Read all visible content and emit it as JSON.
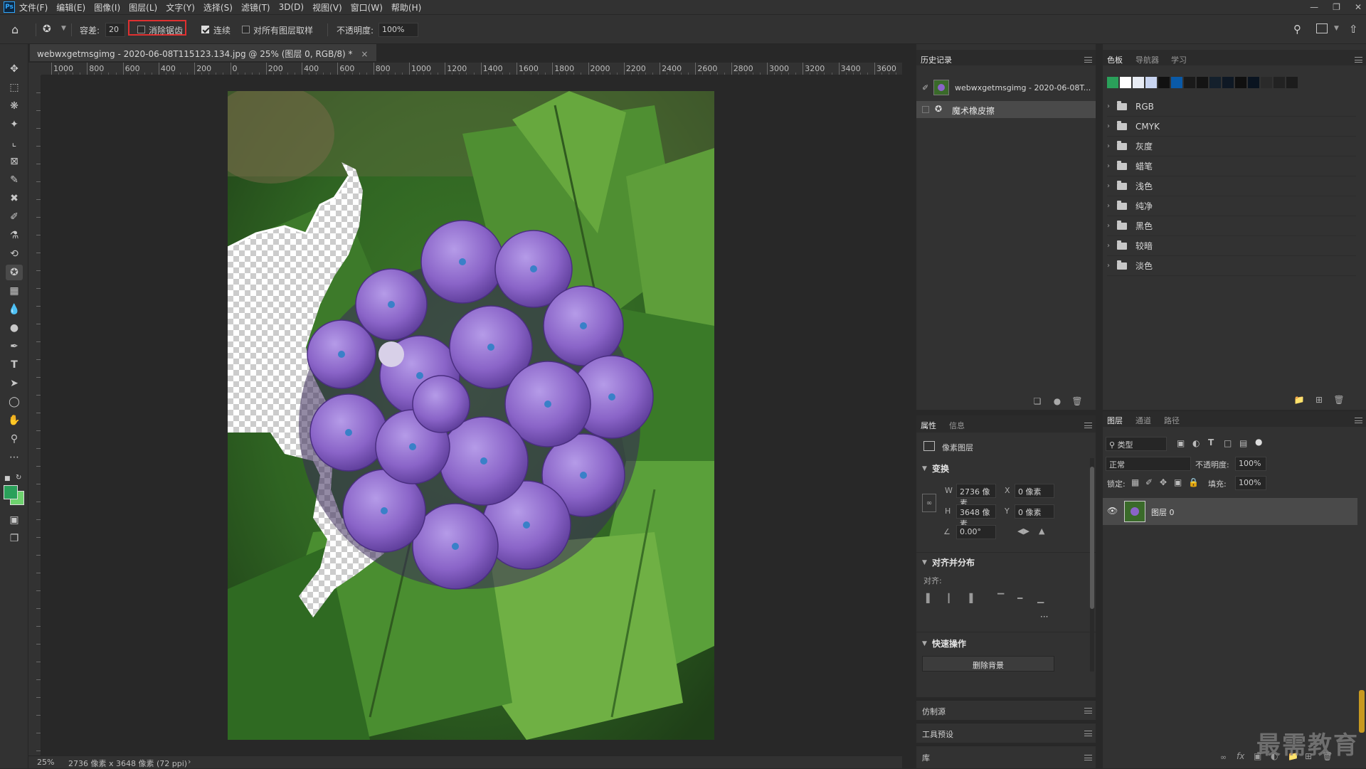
{
  "app": {
    "logo": "Ps"
  },
  "menu": [
    "文件(F)",
    "编辑(E)",
    "图像(I)",
    "图层(L)",
    "文字(Y)",
    "选择(S)",
    "滤镜(T)",
    "3D(D)",
    "视图(V)",
    "窗口(W)",
    "帮助(H)"
  ],
  "options": {
    "tolerance_label": "容差:",
    "tolerance_value": "20",
    "antialias_label": "消除锯齿",
    "contiguous_label": "连续",
    "sample_all_label": "对所有图层取样",
    "opacity_label": "不透明度:",
    "opacity_value": "100%"
  },
  "document": {
    "tab_title": "webwxgetmsgimg - 2020-06-08T115123.134.jpg @ 25% (图层 0, RGB/8) *",
    "ruler_ticks": [
      "1000",
      "800",
      "600",
      "400",
      "200",
      "0",
      "200",
      "400",
      "600",
      "800",
      "1000",
      "1200",
      "1400",
      "1600",
      "1800",
      "2000",
      "2200",
      "2400",
      "2600",
      "2800",
      "3000",
      "3200",
      "3400",
      "3600"
    ],
    "zoom": "25%",
    "info": "2736 像素 x 3648 像素 (72 ppi)"
  },
  "history": {
    "tab": "历史记录",
    "snapshot_label": "webwxgetmsgimg - 2020-06-08T...",
    "step_label": "魔术橡皮擦"
  },
  "swatches": {
    "tabs": [
      "色板",
      "导航器",
      "学习"
    ],
    "colors": [
      "#2aa05a",
      "#ffffff",
      "#e8ecf4",
      "#c8d4f0",
      "#111111",
      "#0a5aa8",
      "#1a1a1a",
      "#141414",
      "#14202c",
      "#0e1824",
      "#101010",
      "#0a1420",
      "#2a2a2a",
      "#222222",
      "#1c1c1c"
    ],
    "groups": [
      "RGB",
      "CMYK",
      "灰度",
      "蜡笔",
      "浅色",
      "纯净",
      "黑色",
      "较暗",
      "淡色"
    ]
  },
  "properties": {
    "tabs": [
      "属性",
      "信息"
    ],
    "layer_type": "像素图层",
    "transform_title": "变换",
    "w_label": "W",
    "w_value": "2736 像素",
    "h_label": "H",
    "h_value": "3648 像素",
    "x_label": "X",
    "x_value": "0 像素",
    "y_label": "Y",
    "y_value": "0 像素",
    "angle_value": "0.00°",
    "align_title": "对齐并分布",
    "align_label": "对齐:",
    "more": "···",
    "quick_title": "快速操作",
    "remove_bg": "删除背景"
  },
  "collapsed_panels": [
    "仿制源",
    "工具预设",
    "库"
  ],
  "layers": {
    "tabs": [
      "图层",
      "通道",
      "路径"
    ],
    "filter_kind": "类型",
    "blend_mode": "正常",
    "opacity_label": "不透明度:",
    "opacity_value": "100%",
    "lock_label": "锁定:",
    "fill_label": "填充:",
    "fill_value": "100%",
    "layer_name": "图层 0"
  },
  "watermark": "最需教育"
}
